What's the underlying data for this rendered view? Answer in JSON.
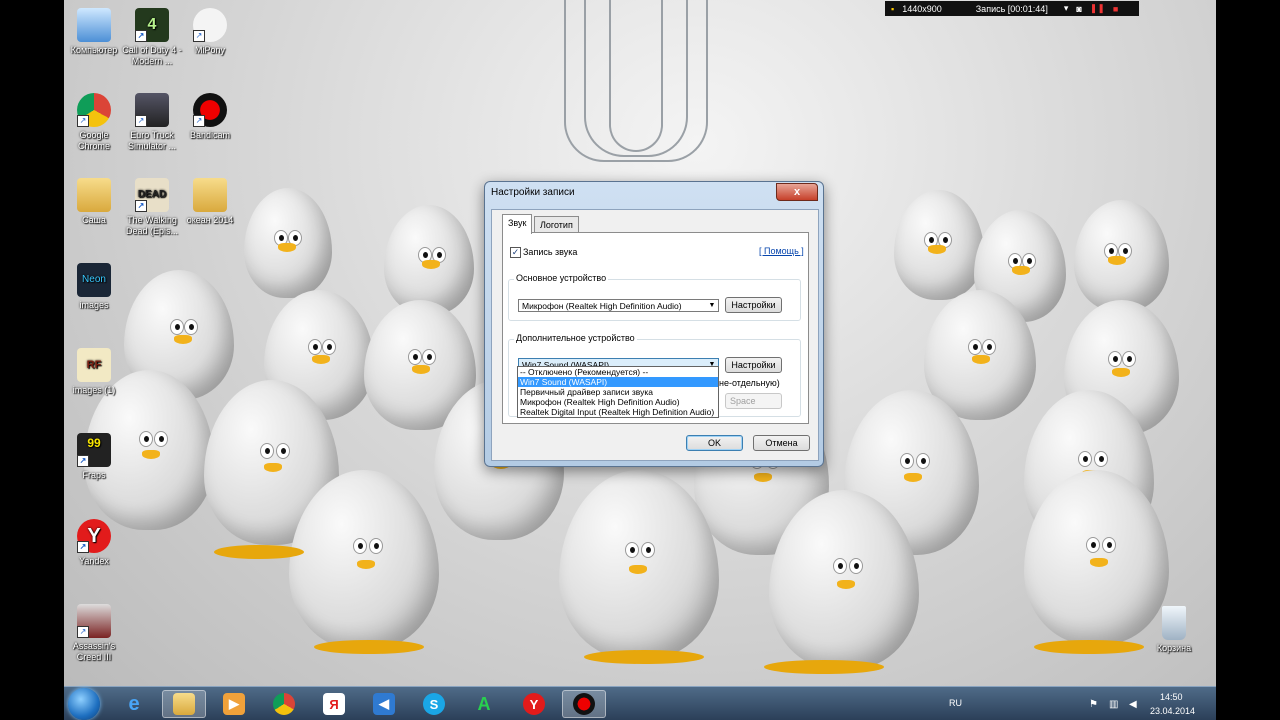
{
  "recorder_bar": {
    "resolution": "1440x900",
    "status": "Запись [00:01:44]"
  },
  "desktop_icons": [
    {
      "label": "Компьютер"
    },
    {
      "label": "Call of Duty 4 - Modern ..."
    },
    {
      "label": "MiPony"
    },
    {
      "label": "Google Chrome"
    },
    {
      "label": "Euro Truck Simulator ..."
    },
    {
      "label": "Bandicam"
    },
    {
      "label": "Саша"
    },
    {
      "label": "The Walking Dead (Epis..."
    },
    {
      "label": "океан 2014"
    },
    {
      "label": "images"
    },
    {
      "label": "images (1)"
    },
    {
      "label": "Fraps"
    },
    {
      "label": "Yandex"
    },
    {
      "label": "Assassin's Creed III"
    },
    {
      "label": "Корзина"
    }
  ],
  "dialog": {
    "title": "Настройки записи",
    "close": "x",
    "tabs": [
      "Звук",
      "Логотип"
    ],
    "record_sound_label": "Запись звука",
    "record_sound_checked": true,
    "help_link": "[ Помощь ]",
    "primary_group": "Основное устройство",
    "primary_device": "Микрофон (Realtek High Definition Audio)",
    "primary_settings": "Настройки",
    "secondary_group": "Дополнительное устройство",
    "secondary_device": "Win7 Sound (WASAPI)",
    "secondary_settings": "Настройки",
    "partial_label": "не-отдельную)",
    "hotkey_value": "Space",
    "dropdown_options": [
      "-- Отключено (Рекомендуется) --",
      "Win7 Sound (WASAPI)",
      "Первичный драйвер записи звука",
      "Микрофон (Realtek High Definition Audio)",
      "Realtek Digital Input (Realtek High Definition Audio)"
    ],
    "selected_option": "Win7 Sound (WASAPI)",
    "ok": "OK",
    "cancel": "Отмена"
  },
  "taskbar": {
    "language": "RU",
    "time": "14:50",
    "date": "23.04.2014",
    "pinned": [
      "start",
      "internet-explorer",
      "explorer",
      "media-player",
      "chrome",
      "yandex",
      "sound",
      "skype",
      "app-a",
      "yandex-browser",
      "bandicam"
    ]
  },
  "colors": {
    "dialog_title_bg": "#cfe0f2",
    "selection": "#3399ff",
    "taskbar": "#2a3e57",
    "beak": "#f2b21b"
  }
}
